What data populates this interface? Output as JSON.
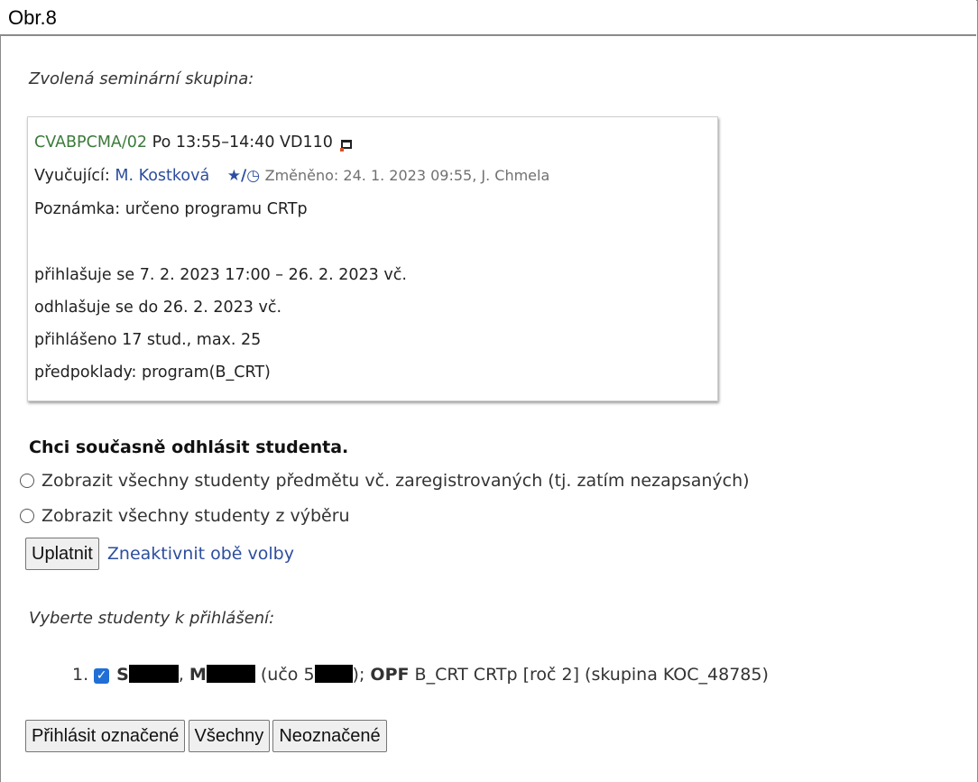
{
  "caption": "Obr.8",
  "selected_label": "Zvolená seminární skupina:",
  "group": {
    "code": "CVABPCMA/02",
    "time": "Po 13:55–14:40",
    "room": "VD110",
    "teacher_label": "Vyučující:",
    "teacher": "M. Kostková",
    "changed": "Změněno: 24. 1. 2023 09:55, J. Chmela",
    "note": "Poznámka: určeno programu CRTp",
    "signup": "přihlašuje se 7. 2. 2023 17:00 – 26. 2. 2023 vč.",
    "signoff": "odhlašuje se do 26. 2. 2023 vč.",
    "enrolled": "přihlášeno 17 stud., max. 25",
    "prereq": "předpoklady: program(B_CRT)"
  },
  "unenroll_heading": "Chci současně odhlásit studenta.",
  "options": [
    "Zobrazit všechny studenty předmětu vč. zaregistrovaných (tj. zatím nezapsaných)",
    "Zobrazit všechny studenty z výběru"
  ],
  "apply_button": "Uplatnit",
  "deactivate_link": "Zneaktivnit obě volby",
  "choose_label": "Vyberte studenty k přihlášení:",
  "student": {
    "number": "1.",
    "surname_initial": "S",
    "name_initial": "M",
    "uco_prefix": "(učo 5",
    "uco_suffix": ");",
    "faculty": "OPF",
    "details": "B_CRT CRTp [roč 2] (skupina KOC_48785)"
  },
  "buttons": {
    "enroll_selected": "Přihlásit označené",
    "all": "Všechny",
    "unselected": "Neoznačené"
  },
  "icons": [
    "external-window-icon",
    "history-icon",
    "checkbox-checked-icon",
    "radio-icon"
  ]
}
